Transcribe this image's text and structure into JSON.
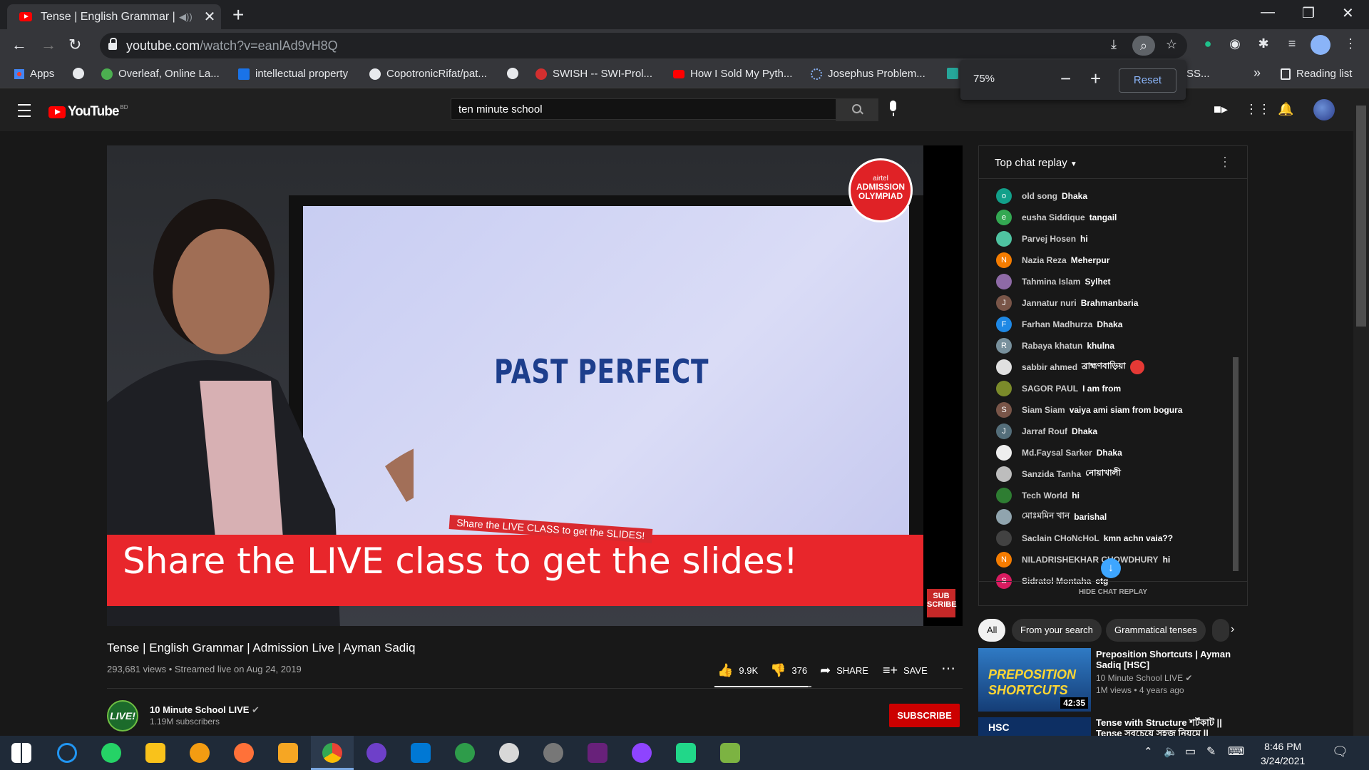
{
  "browser": {
    "tab_title": "Tense | English Grammar | Ad",
    "url_domain": "youtube.com",
    "url_path": "/watch?v=eanlAd9vH8Q",
    "bookmarks": [
      "Apps",
      "Overleaf, Online La...",
      "intellectual property",
      "CopotronicRifat/pat...",
      "SWISH -- SWI-Prol...",
      "How I Sold My Pyth...",
      "Josephus Problem...",
      "SS...",
      "Reading list"
    ],
    "more_bookmarks": "»",
    "zoom": {
      "percent": "75%",
      "minus": "−",
      "plus": "+",
      "reset": "Reset"
    }
  },
  "masthead": {
    "logo": "YouTube",
    "country": "BD",
    "search_query": "ten minute school"
  },
  "video": {
    "slide_title": "PAST PERFECT",
    "banner_text": "Share the LIVE class to get the slides!",
    "banner_small": "Share the LIVE CLASS to get the SLIDES!",
    "badge_top": "airtel",
    "badge_main": "ADMISSION OLYMPIAD",
    "subscribe_overlay": "SUB SCRIBE",
    "title": "Tense | English Grammar | Admission Live | Ayman Sadiq",
    "meta": "293,681 views • Streamed live on Aug 24, 2019",
    "likes": "9.9K",
    "dislikes": "376",
    "like_ratio": 0.963,
    "share": "SHARE",
    "save": "SAVE"
  },
  "channel": {
    "avatar_text": "LIVE!",
    "name": "10 Minute School LIVE",
    "subs": "1.19M subscribers",
    "subscribe": "SUBSCRIBE"
  },
  "chat": {
    "header": "Top chat replay",
    "hide": "HIDE CHAT REPLAY",
    "messages": [
      {
        "author": "old song",
        "text": "Dhaka",
        "initial": "o",
        "color": "#12a08a"
      },
      {
        "author": "eusha Siddique",
        "text": "tangail",
        "initial": "e",
        "color": "#33a852"
      },
      {
        "author": "Parvej Hosen",
        "text": "hi",
        "initial": "",
        "color": "#4fc3a1"
      },
      {
        "author": "Nazia Reza",
        "text": "Meherpur",
        "initial": "N",
        "color": "#f57c00"
      },
      {
        "author": "Tahmina Islam",
        "text": "Sylhet",
        "initial": "",
        "color": "#8e6aa6"
      },
      {
        "author": "Jannatur nuri",
        "text": "Brahmanbaria",
        "initial": "J",
        "color": "#795548"
      },
      {
        "author": "Farhan Madhurza",
        "text": "Dhaka",
        "initial": "F",
        "color": "#1e88e5"
      },
      {
        "author": "Rabaya khatun",
        "text": "khulna",
        "initial": "R",
        "color": "#78909c"
      },
      {
        "author": "sabbir ahmed",
        "text": "ব্রাহ্মণবাড়িয়া",
        "initial": "",
        "color": "#e0e0e0"
      },
      {
        "author": "SAGOR PAUL",
        "text": "I am from",
        "initial": "",
        "color": "#7b8a2a"
      },
      {
        "author": "Siam Siam",
        "text": "vaiya ami siam from bogura",
        "initial": "S",
        "color": "#795548"
      },
      {
        "author": "Jarraf Rouf",
        "text": "Dhaka",
        "initial": "J",
        "color": "#546e7a"
      },
      {
        "author": "Md.Faysal Sarker",
        "text": "Dhaka",
        "initial": "",
        "color": "#eeeeee"
      },
      {
        "author": "Sanzida Tanha",
        "text": "নোয়াখালী",
        "initial": "",
        "color": "#bdbdbd"
      },
      {
        "author": "Tech World",
        "text": "hi",
        "initial": "",
        "color": "#2e7d32"
      },
      {
        "author": "মোঃমমিন খান",
        "text": "barishal",
        "initial": "",
        "color": "#90a4ae"
      },
      {
        "author": "Saclain CHoNcHoL",
        "text": "kmn achn vaia??",
        "initial": "",
        "color": "#424242"
      },
      {
        "author": "NILADRISHEKHAR CHOWDHURY",
        "text": "hi",
        "initial": "N",
        "color": "#f57c00"
      },
      {
        "author": "Sidratol Montaha",
        "text": "ctg",
        "initial": "S",
        "color": "#d81b60"
      }
    ]
  },
  "chips": [
    "All",
    "From your search",
    "Grammatical tenses"
  ],
  "related": [
    {
      "title": "Preposition Shortcuts | Ayman Sadiq [HSC]",
      "channel": "10 Minute School LIVE",
      "meta": "1M views • 4 years ago",
      "duration": "42:35",
      "thumb_text": "PREPOSITION SHORTCUTS"
    },
    {
      "title": "Tense with Structure শর্টকাট || Tense সবচেয়ে সহজ নিয়মে ||",
      "channel": "",
      "meta": "",
      "duration": "",
      "thumb_text": "HSC"
    }
  ],
  "taskbar": {
    "time": "8:46 PM",
    "date": "3/24/2021"
  }
}
